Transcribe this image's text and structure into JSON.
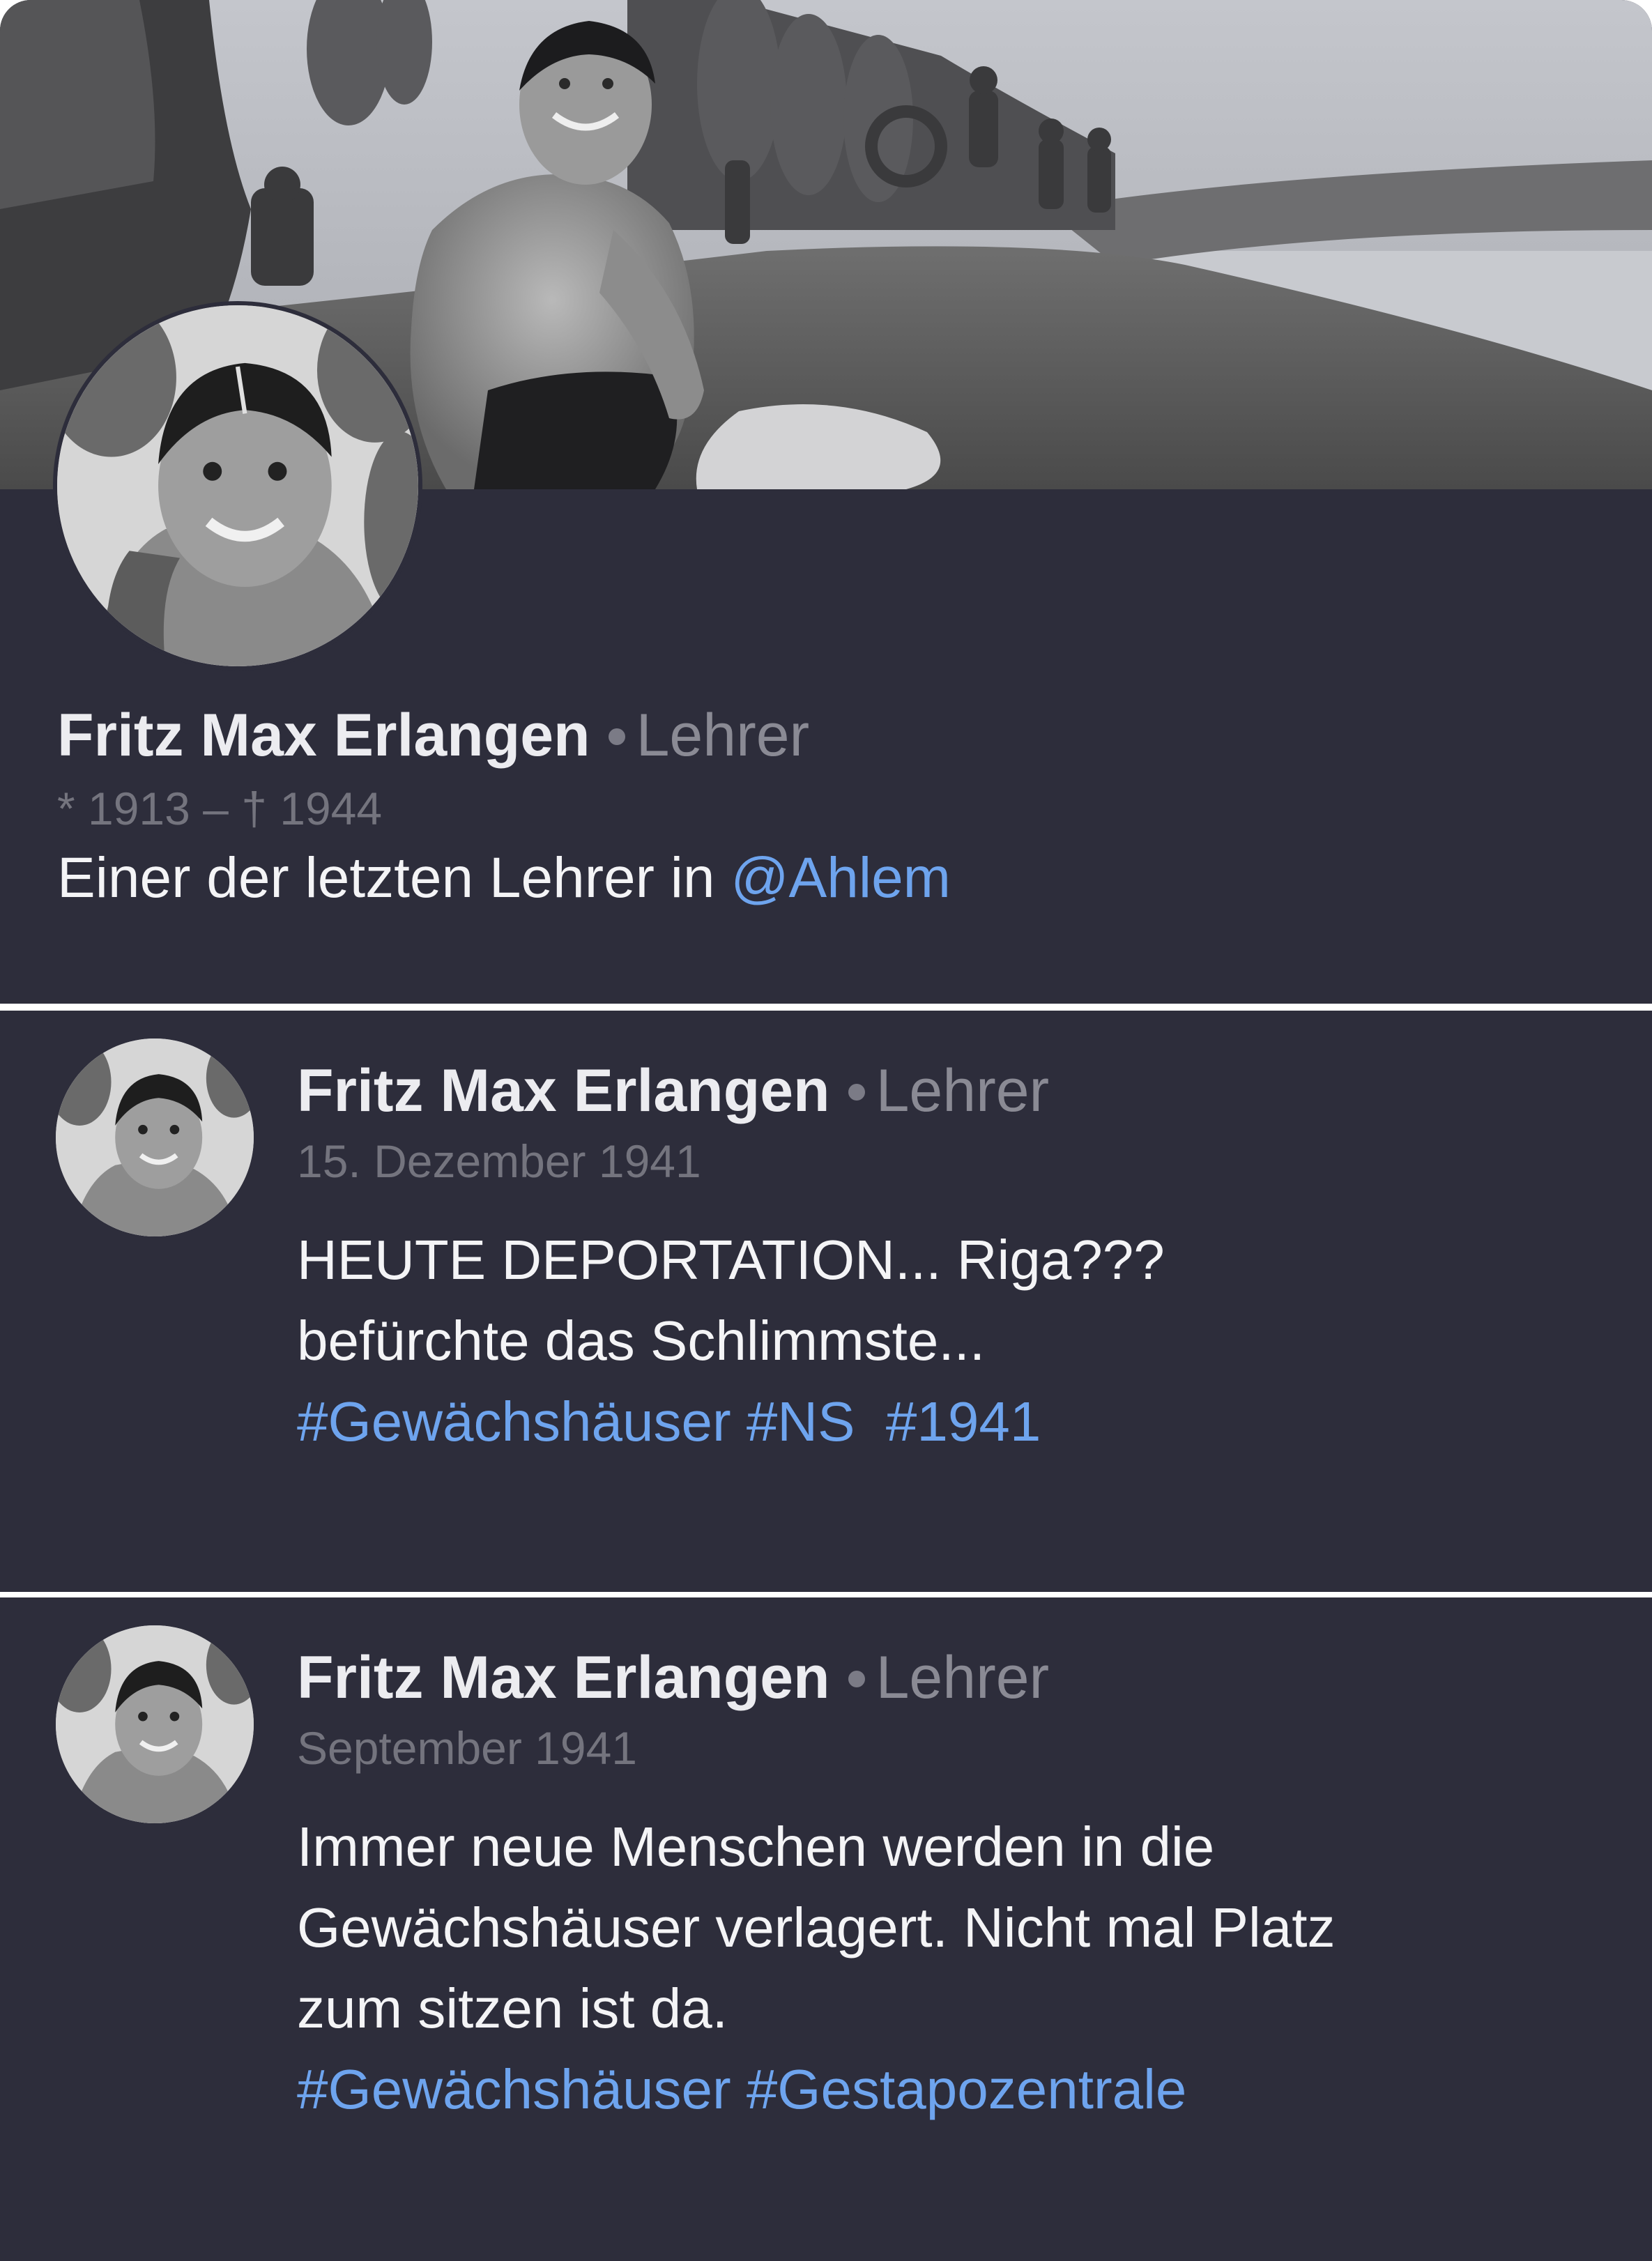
{
  "profile": {
    "name": "Fritz Max Erlangen",
    "role": "Lehrer",
    "dates": "* 1913 – † 1944",
    "bio_text": "Einer der letzten Lehrer in ",
    "bio_mention": "@Ahlem"
  },
  "posts": [
    {
      "author": "Fritz Max Erlangen",
      "role": "Lehrer",
      "date": "15. Dezember 1941",
      "lines": [
        "HEUTE DEPORTATION... Riga???",
        "befürchte das Schlimmste..."
      ],
      "hashtags": [
        "#Gewächshäuser",
        "#NS",
        "#1941"
      ]
    },
    {
      "author": "Fritz Max Erlangen",
      "role": "Lehrer",
      "date": "September 1941",
      "lines": [
        "Immer neue Menschen werden in die",
        "Gewächshäuser verlagert. Nicht mal Platz",
        "zum sitzen ist da."
      ],
      "hashtags": [
        "#Gewächshäuser",
        "#Gestapozentrale"
      ]
    }
  ],
  "colors": {
    "card_background": "#2d2d3b",
    "link": "#6ea4ee",
    "muted_text": "#74747e"
  }
}
